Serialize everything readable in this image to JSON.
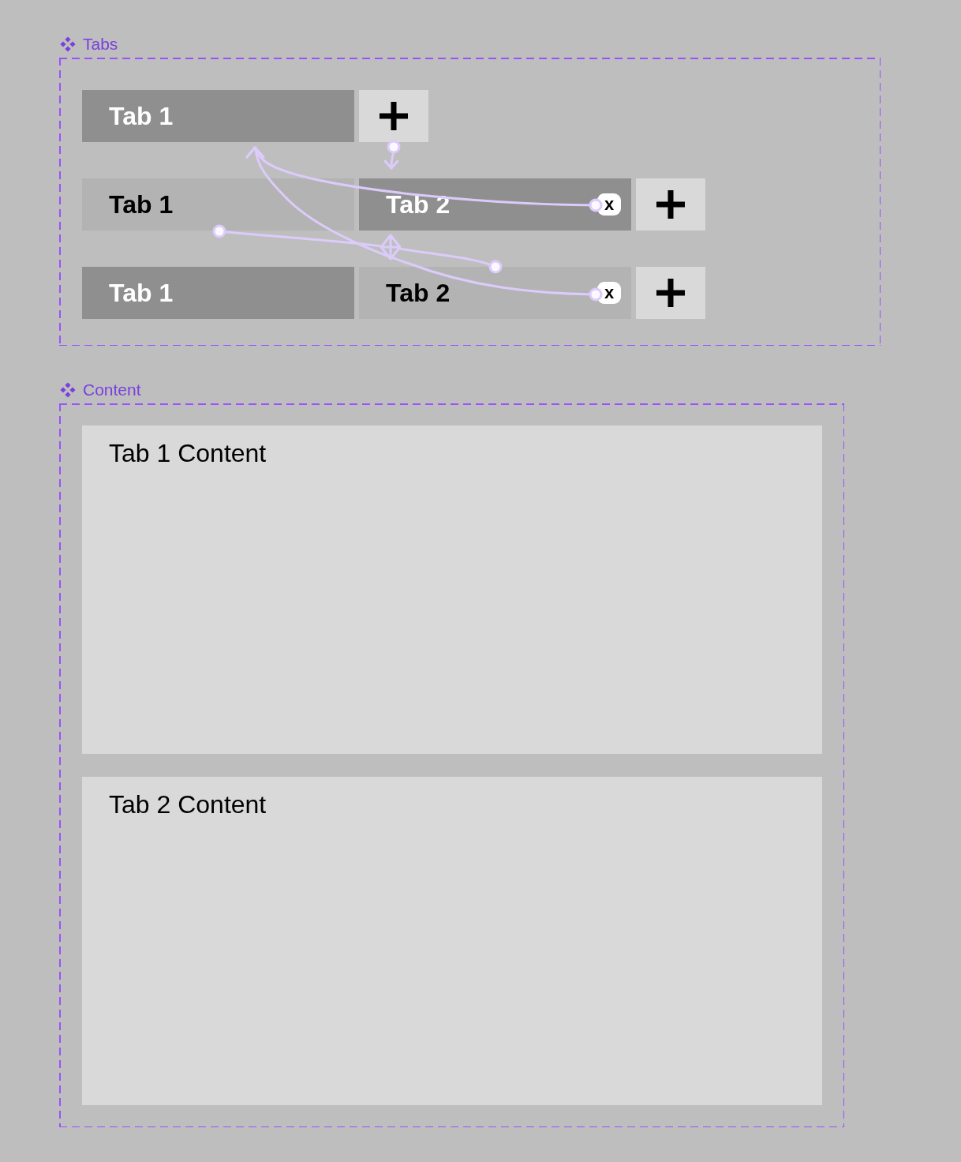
{
  "sections": [
    {
      "kind": "tab_bars",
      "title": "Tabs",
      "variants": [
        {
          "tabs": [
            {
              "label": "Tab 1",
              "selected": true
            }
          ],
          "add_button": true
        },
        {
          "tabs": [
            {
              "label": "Tab 1",
              "selected": false
            },
            {
              "label": "Tab 2",
              "selected": true,
              "close": "x"
            }
          ],
          "add_button": true
        },
        {
          "tabs": [
            {
              "label": "Tab 1",
              "selected": true
            },
            {
              "label": "Tab 2",
              "selected": false,
              "close": "x"
            }
          ],
          "add_button": true
        }
      ]
    },
    {
      "kind": "panels",
      "title": "Content",
      "panels": [
        {
          "text": "Tab 1 Content"
        },
        {
          "text": "Tab 2 Content"
        }
      ]
    }
  ]
}
